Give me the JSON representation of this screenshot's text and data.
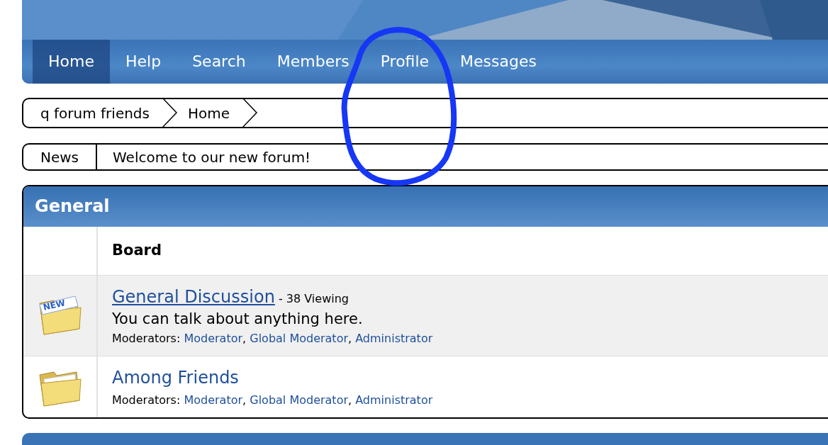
{
  "nav": [
    {
      "label": "Home",
      "selected": true
    },
    {
      "label": "Help",
      "selected": false
    },
    {
      "label": "Search",
      "selected": false
    },
    {
      "label": "Members",
      "selected": false
    },
    {
      "label": "Profile",
      "selected": false
    },
    {
      "label": "Messages",
      "selected": false
    }
  ],
  "breadcrumb": [
    "q forum friends",
    "Home"
  ],
  "news": {
    "label": "News",
    "text": "Welcome to our new forum!"
  },
  "category": {
    "title": "General",
    "column_header": "Board",
    "boards": [
      {
        "name": "General Discussion",
        "viewing": "- 38 Viewing",
        "new_badge": "NEW",
        "highlighted": true,
        "description": "You can talk about anything here.",
        "moderators_label": "Moderators:",
        "separator": ",",
        "moderators": [
          "Moderator",
          "Global Moderator",
          "Administrator"
        ]
      },
      {
        "name": "Among Friends",
        "highlighted": false,
        "moderators_label": "Moderators:",
        "separator": ",",
        "moderators": [
          "Moderator",
          "Global Moderator",
          "Administrator"
        ]
      }
    ]
  },
  "annotation": {
    "kind": "circle",
    "color": "#1637f5"
  }
}
